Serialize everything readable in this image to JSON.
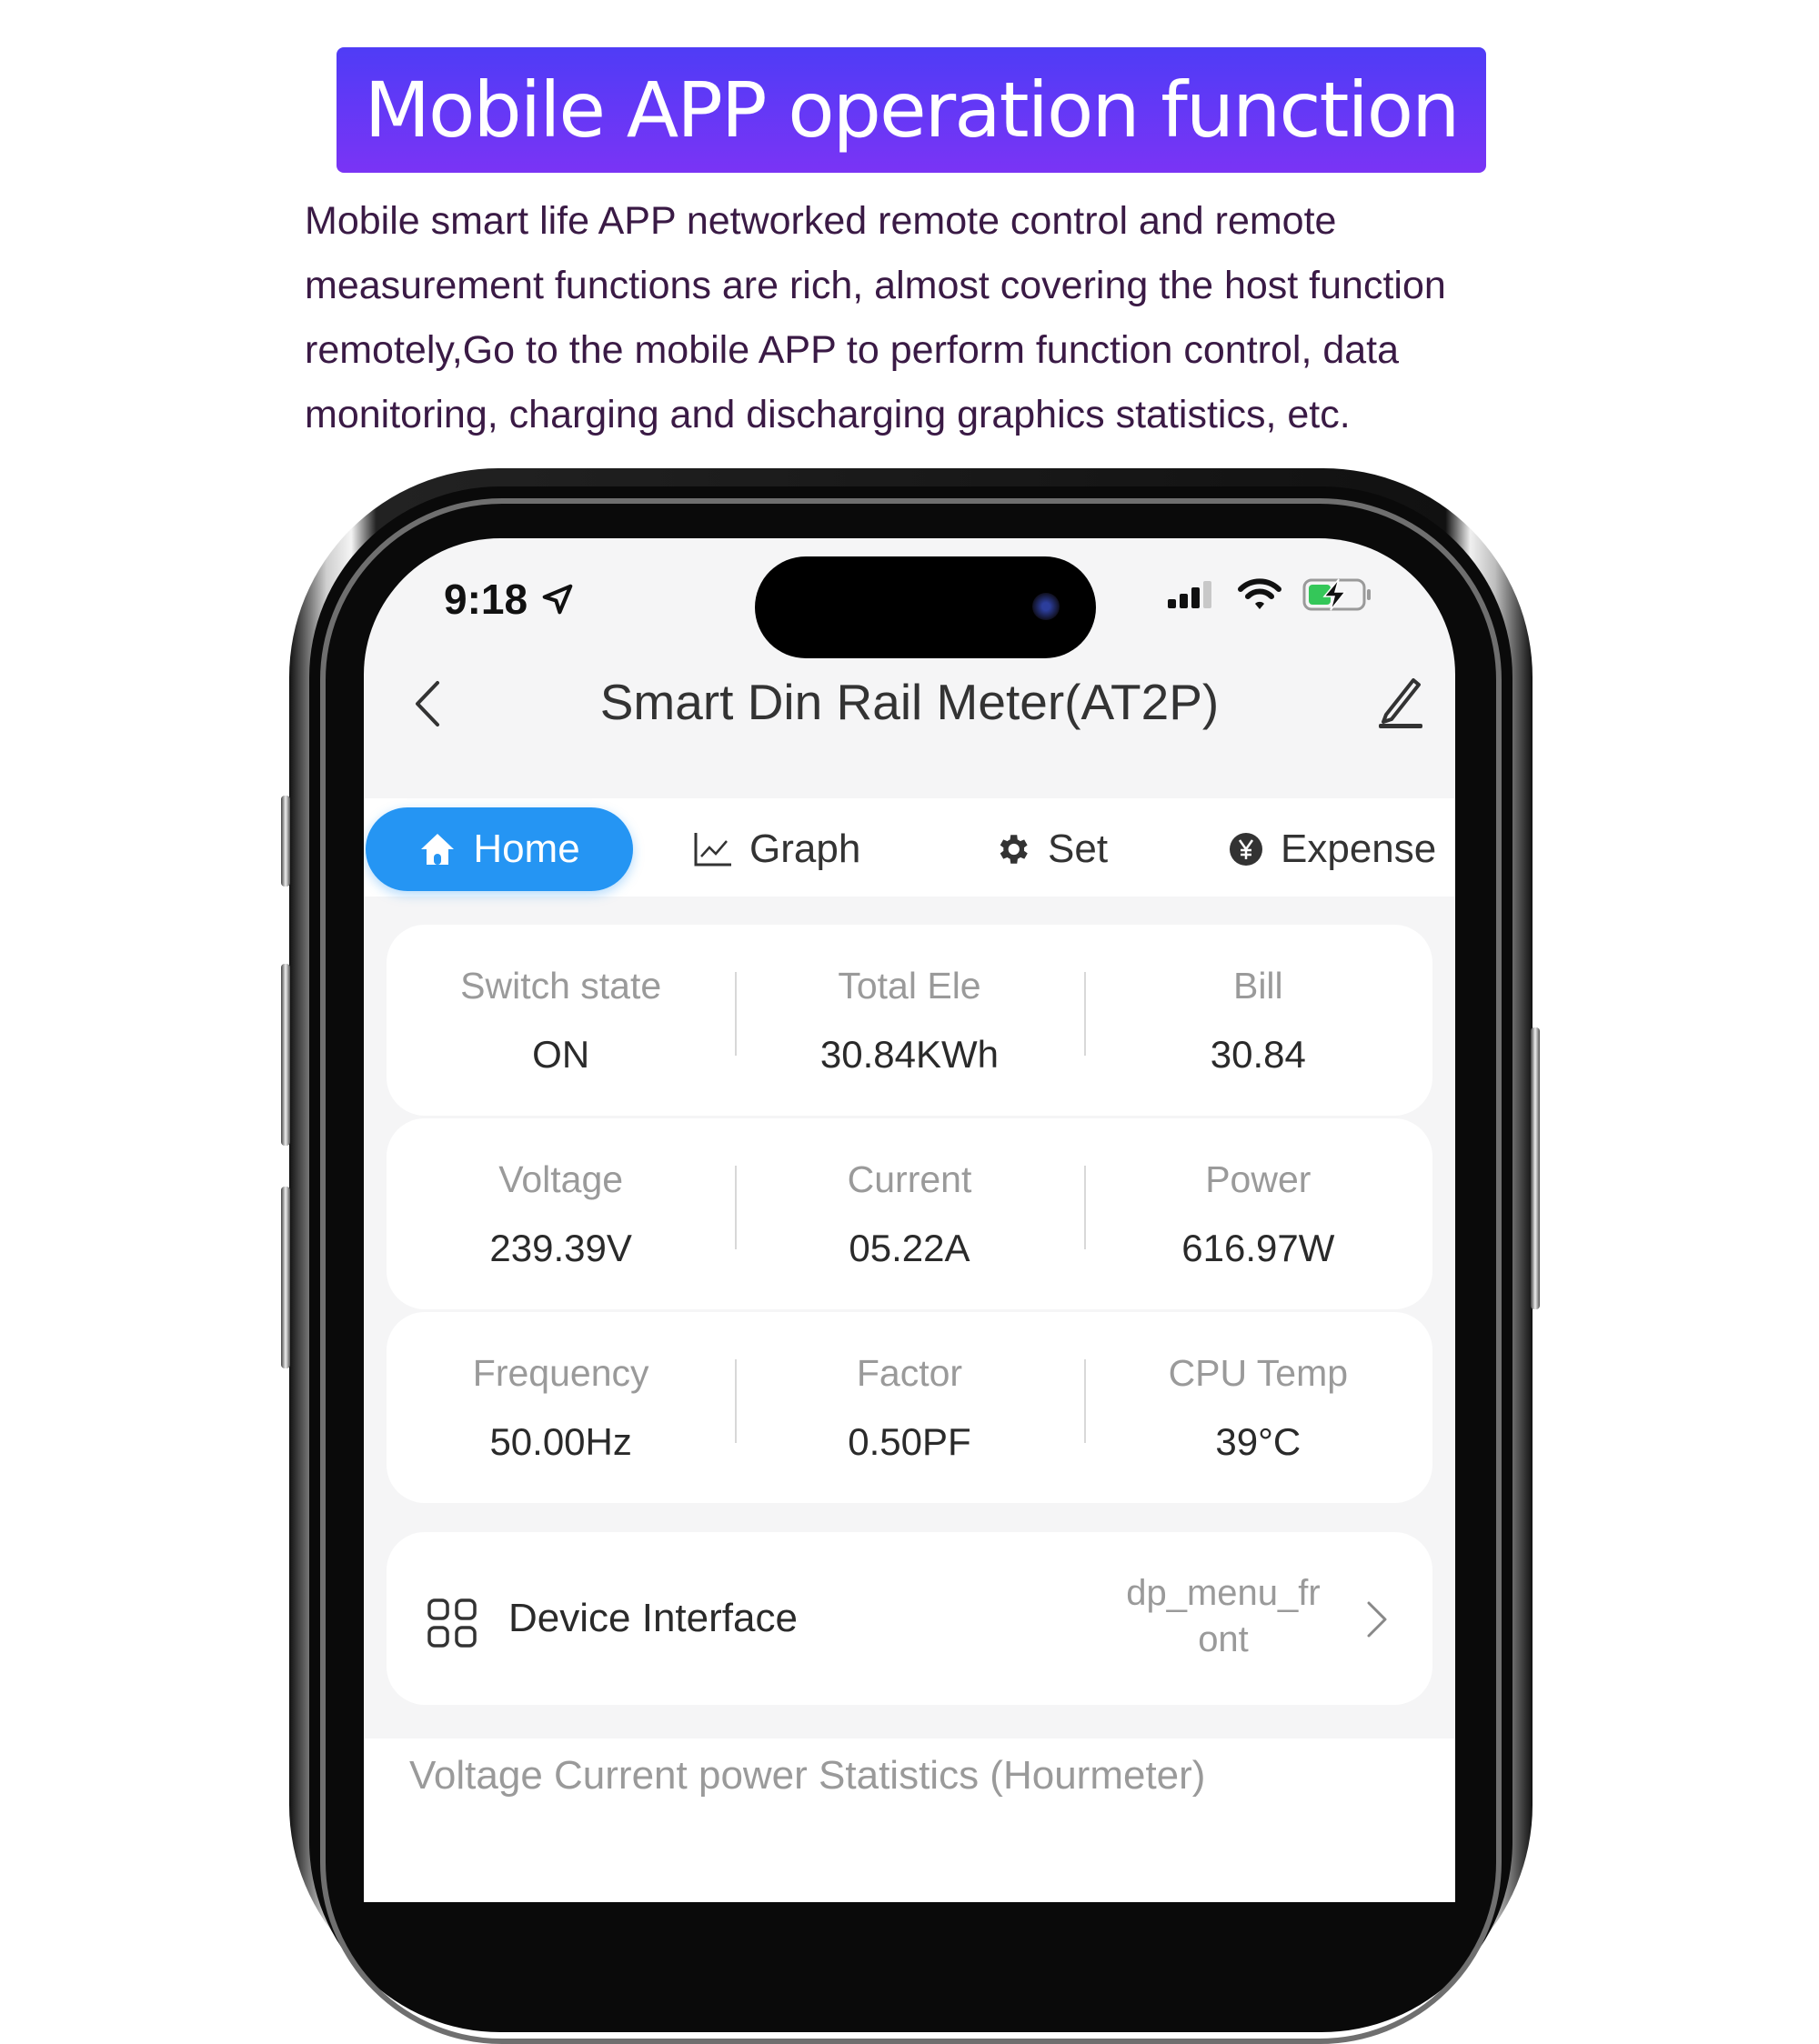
{
  "banner": {
    "title": "Mobile APP operation function"
  },
  "intro": {
    "lines": [
      "Mobile smart life APP networked remote control and remote",
      "measurement functions are rich, almost covering the host function",
      "remotely,Go to the mobile APP to perform function control, data",
      "monitoring, charging and discharging graphics statistics, etc."
    ]
  },
  "status_bar": {
    "time": "9:18",
    "location_icon": "location-arrow-icon",
    "signal_icon": "cellular-signal-icon",
    "wifi_icon": "wifi-icon",
    "battery_icon": "battery-charging-icon",
    "battery_color": "#34c759"
  },
  "header": {
    "title": "Smart Din Rail Meter(AT2P)",
    "back_icon": "chevron-left-icon",
    "edit_icon": "pencil-icon"
  },
  "tabs": [
    {
      "label": "Home",
      "icon": "home-icon",
      "active": true
    },
    {
      "label": "Graph",
      "icon": "line-chart-icon",
      "active": false
    },
    {
      "label": "Set",
      "icon": "gear-icon",
      "active": false
    },
    {
      "label": "Expense",
      "icon": "yen-coin-icon",
      "active": false
    }
  ],
  "accent_color": "#2595f3",
  "metrics": [
    [
      {
        "label": "Switch state",
        "value": "ON"
      },
      {
        "label": "Total Ele",
        "value": "30.84KWh"
      },
      {
        "label": "Bill",
        "value": "30.84"
      }
    ],
    [
      {
        "label": "Voltage",
        "value": "239.39V"
      },
      {
        "label": "Current",
        "value": "05.22A"
      },
      {
        "label": "Power",
        "value": "616.97W"
      }
    ],
    [
      {
        "label": "Frequency",
        "value": "50.00Hz"
      },
      {
        "label": "Factor",
        "value": "0.50PF"
      },
      {
        "label": "CPU Temp",
        "value": "39°C"
      }
    ]
  ],
  "device_interface": {
    "label": "Device Interface",
    "value_line1": "dp_menu_fr",
    "value_line2": "ont",
    "icon": "grid-icon",
    "chevron_icon": "chevron-right-icon"
  },
  "stats": {
    "title": "Voltage Current power Statistics (Hourmeter)"
  }
}
